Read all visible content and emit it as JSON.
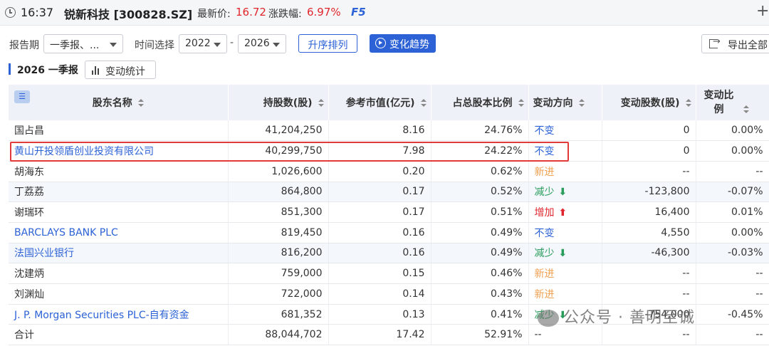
{
  "topbar": {
    "time": "16:37",
    "stock": "锐新科技 [300828.SZ]",
    "price_label": "最新价:",
    "price": "16.72",
    "change_label": "涨跌幅:",
    "change": "6.97%",
    "refresh": "F5",
    "plus": "+"
  },
  "filters": {
    "period_label": "报告期",
    "period_value": "一季报、...",
    "time_label": "时间选择",
    "year_from": "2022",
    "dash": "-",
    "year_to": "2026",
    "sort_button": "升序排列",
    "trend_button": "变化趋势",
    "export_button": "导出全部"
  },
  "section": {
    "title": "2026 一季报",
    "stats_button": "变动统计"
  },
  "table": {
    "headers": [
      "股东名称",
      "持股数(股)",
      "参考市值(亿元)",
      "占总股本比例",
      "变动方向",
      "变动股数(股)",
      "变动比例"
    ],
    "rows": [
      {
        "name": "国占昌",
        "shares": "41,204,250",
        "value": "8.16",
        "ratio": "24.76%",
        "dir": "不变",
        "dir_type": "same",
        "chg": "0",
        "chg_ratio": "0.00%",
        "link": false
      },
      {
        "name": "黄山开投领盾创业投资有限公司",
        "shares": "40,299,750",
        "value": "7.98",
        "ratio": "24.22%",
        "dir": "不变",
        "dir_type": "same",
        "chg": "0",
        "chg_ratio": "0.00%",
        "link": true
      },
      {
        "name": "胡海东",
        "shares": "1,026,600",
        "value": "0.20",
        "ratio": "0.62%",
        "dir": "新进",
        "dir_type": "new",
        "chg": "--",
        "chg_ratio": "--",
        "link": false
      },
      {
        "name": "丁荔荔",
        "shares": "864,800",
        "value": "0.17",
        "ratio": "0.52%",
        "dir": "减少",
        "dir_type": "down",
        "chg": "-123,800",
        "chg_ratio": "-0.07%",
        "link": false
      },
      {
        "name": "谢瑞环",
        "shares": "851,300",
        "value": "0.17",
        "ratio": "0.51%",
        "dir": "增加",
        "dir_type": "up",
        "chg": "16,400",
        "chg_ratio": "0.01%",
        "link": false
      },
      {
        "name": "BARCLAYS BANK PLC",
        "shares": "819,450",
        "value": "0.16",
        "ratio": "0.49%",
        "dir": "不变",
        "dir_type": "same",
        "chg": "4,550",
        "chg_ratio": "0.00%",
        "link": true
      },
      {
        "name": "法国兴业银行",
        "shares": "816,200",
        "value": "0.16",
        "ratio": "0.49%",
        "dir": "减少",
        "dir_type": "down",
        "chg": "-46,300",
        "chg_ratio": "-0.03%",
        "link": true
      },
      {
        "name": "沈建炳",
        "shares": "759,000",
        "value": "0.15",
        "ratio": "0.46%",
        "dir": "新进",
        "dir_type": "new",
        "chg": "--",
        "chg_ratio": "--",
        "link": false
      },
      {
        "name": "刘渊灿",
        "shares": "722,000",
        "value": "0.14",
        "ratio": "0.43%",
        "dir": "新进",
        "dir_type": "new",
        "chg": "--",
        "chg_ratio": "--",
        "link": false
      },
      {
        "name": "J. P. Morgan Securities PLC-自有资金",
        "shares": "681,352",
        "value": "0.13",
        "ratio": "0.41%",
        "dir": "减少",
        "dir_type": "down",
        "chg": "-754,000",
        "chg_ratio": "-0.45%",
        "link": true
      }
    ],
    "total": {
      "name": "合计",
      "shares": "88,044,702",
      "value": "17.42",
      "ratio": "52.91%",
      "dir": "--",
      "chg": "--",
      "chg_ratio": "--"
    }
  },
  "watermark": "公众号 · 善明至诚",
  "colors": {
    "accent": "#2c62d6",
    "up": "#e0262c",
    "down": "#2a9d5c",
    "new": "#f0a050",
    "highlight_box": "#e23a3a"
  }
}
